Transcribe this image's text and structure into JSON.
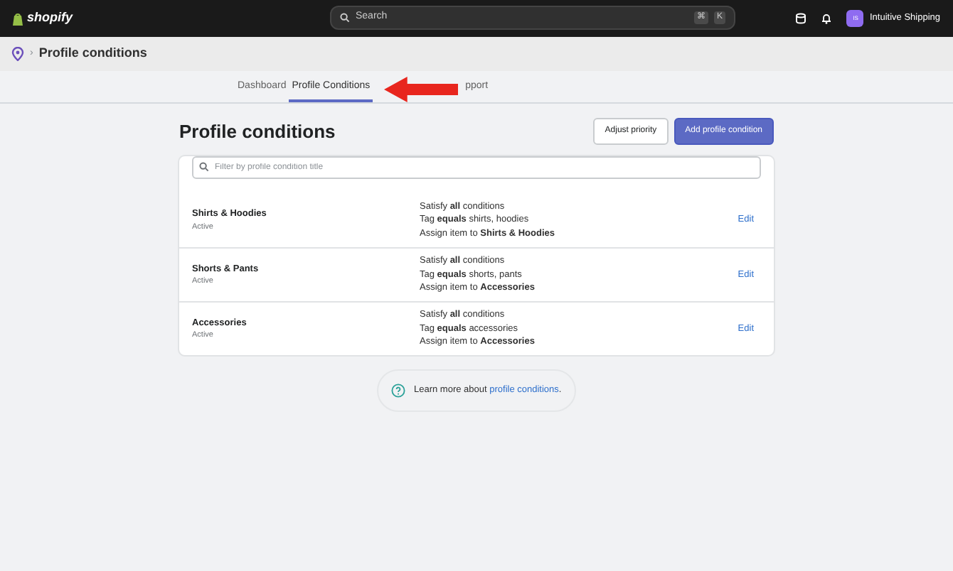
{
  "topbar": {
    "logo": "shopify",
    "search": {
      "placeholder": "Search",
      "shortcut_keys": [
        "⌘",
        "K"
      ]
    },
    "store": {
      "initials": "IS",
      "name": "Intuitive Shipping"
    }
  },
  "breadcrumb": {
    "separator": "›",
    "title": "Profile conditions"
  },
  "tabs": [
    {
      "label": "Dashboard",
      "selected": false
    },
    {
      "label": "Profile Conditions",
      "selected": true
    },
    {
      "label": "pport",
      "selected": false
    }
  ],
  "page": {
    "title": "Profile conditions",
    "buttons": [
      {
        "label": "Adjust priority",
        "kind": "secondary"
      },
      {
        "label": "Add profile condition",
        "kind": "primary"
      }
    ]
  },
  "filter": {
    "placeholder": "Filter by profile condition title"
  },
  "conditions": [
    {
      "name": "Shirts & Hoodies",
      "status": "Active",
      "rules": [
        "Satisfy **all** conditions",
        "Tag **equals** shirts, hoodies",
        "Assign item to **Shirts & Hoodies**"
      ],
      "action": "Edit"
    },
    {
      "name": "Shorts & Pants",
      "status": "Active",
      "rules": [
        "Satisfy **all** conditions",
        "Tag **equals** shorts, pants",
        "Assign item to **Accessories**"
      ],
      "action": "Edit"
    },
    {
      "name": "Accessories",
      "status": "Active",
      "rules": [
        "Satisfy **all** conditions",
        "Tag **equals** accessories",
        "Assign item to **Accessories**"
      ],
      "action": "Edit"
    }
  ],
  "help": {
    "text": "Learn more about",
    "link": "profile conditions",
    "end": "."
  }
}
